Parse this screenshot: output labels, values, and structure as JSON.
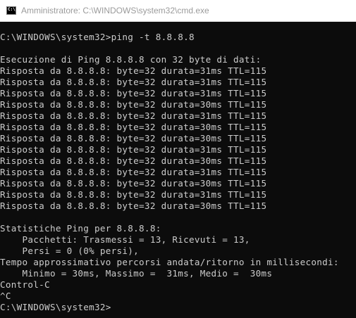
{
  "window": {
    "title": "Amministratore: C:\\WINDOWS\\system32\\cmd.exe",
    "icon": "cmd-icon",
    "icon_glyph": "C:\\"
  },
  "console": {
    "lines": [
      "C:\\WINDOWS\\system32>ping -t 8.8.8.8",
      "",
      "Esecuzione di Ping 8.8.8.8 con 32 byte di dati:",
      "Risposta da 8.8.8.8: byte=32 durata=31ms TTL=115",
      "Risposta da 8.8.8.8: byte=32 durata=31ms TTL=115",
      "Risposta da 8.8.8.8: byte=32 durata=31ms TTL=115",
      "Risposta da 8.8.8.8: byte=32 durata=30ms TTL=115",
      "Risposta da 8.8.8.8: byte=32 durata=31ms TTL=115",
      "Risposta da 8.8.8.8: byte=32 durata=30ms TTL=115",
      "Risposta da 8.8.8.8: byte=32 durata=30ms TTL=115",
      "Risposta da 8.8.8.8: byte=32 durata=31ms TTL=115",
      "Risposta da 8.8.8.8: byte=32 durata=30ms TTL=115",
      "Risposta da 8.8.8.8: byte=32 durata=31ms TTL=115",
      "Risposta da 8.8.8.8: byte=32 durata=30ms TTL=115",
      "Risposta da 8.8.8.8: byte=32 durata=31ms TTL=115",
      "Risposta da 8.8.8.8: byte=32 durata=30ms TTL=115",
      "",
      "Statistiche Ping per 8.8.8.8:",
      "    Pacchetti: Trasmessi = 13, Ricevuti = 13,",
      "    Persi = 0 (0% persi),",
      "Tempo approssimativo percorsi andata/ritorno in millisecondi:",
      "    Minimo = 30ms, Massimo =  31ms, Medio =  30ms",
      "Control-C",
      "^C",
      "C:\\WINDOWS\\system32>"
    ]
  },
  "colors": {
    "console_background": "#0c0c0c",
    "console_text": "#cccccc",
    "titlebar_background": "#ffffff",
    "titlebar_text": "#9b9b9b"
  }
}
